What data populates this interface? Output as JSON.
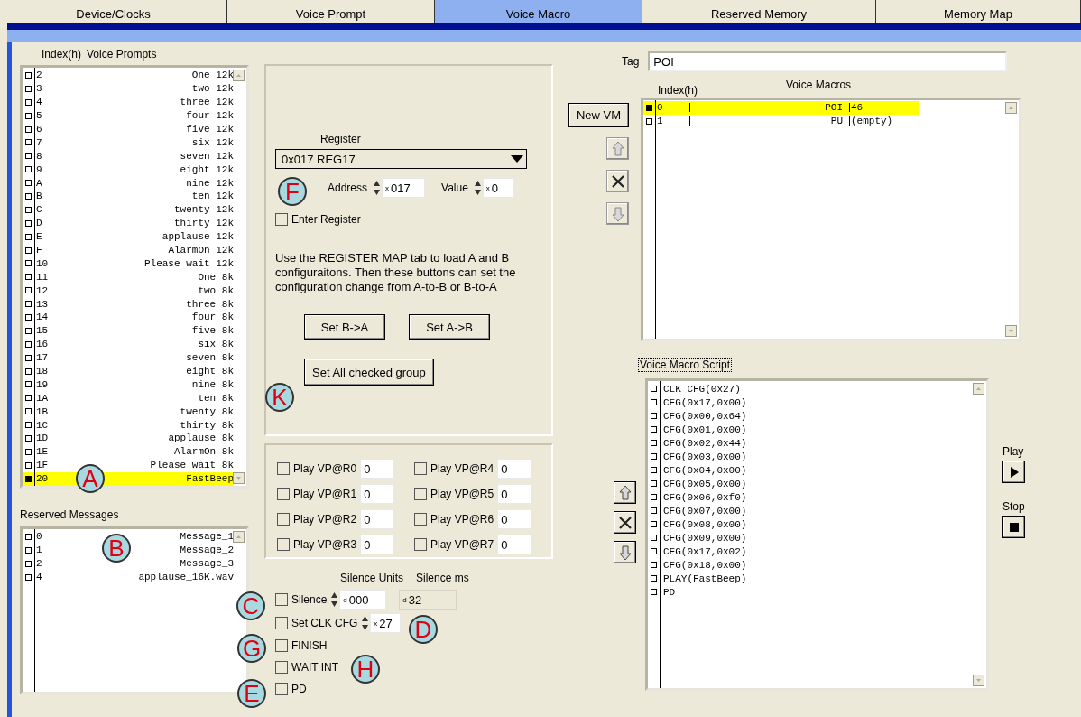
{
  "tabs": [
    {
      "label": "Device/Clocks",
      "selected": false
    },
    {
      "label": "Voice Prompt",
      "selected": false
    },
    {
      "label": "Voice Macro",
      "selected": true
    },
    {
      "label": "Reserved Memory",
      "selected": false
    },
    {
      "label": "Memory Map",
      "selected": false
    }
  ],
  "voice_prompts": {
    "index_header": "Index(h)",
    "title": "Voice Prompts",
    "rows": [
      {
        "index": "2",
        "name": "One 12k",
        "selected": false
      },
      {
        "index": "3",
        "name": "two 12k",
        "selected": false
      },
      {
        "index": "4",
        "name": "three 12k",
        "selected": false
      },
      {
        "index": "5",
        "name": "four 12k",
        "selected": false
      },
      {
        "index": "6",
        "name": "five 12k",
        "selected": false
      },
      {
        "index": "7",
        "name": "six 12k",
        "selected": false
      },
      {
        "index": "8",
        "name": "seven 12k",
        "selected": false
      },
      {
        "index": "9",
        "name": "eight 12k",
        "selected": false
      },
      {
        "index": "A",
        "name": "nine 12k",
        "selected": false
      },
      {
        "index": "B",
        "name": "ten 12k",
        "selected": false
      },
      {
        "index": "C",
        "name": "twenty 12k",
        "selected": false
      },
      {
        "index": "D",
        "name": "thirty 12k",
        "selected": false
      },
      {
        "index": "E",
        "name": "applause 12k",
        "selected": false
      },
      {
        "index": "F",
        "name": "AlarmOn 12k",
        "selected": false
      },
      {
        "index": "10",
        "name": "Please wait 12k",
        "selected": false
      },
      {
        "index": "11",
        "name": "One 8k",
        "selected": false
      },
      {
        "index": "12",
        "name": "two 8k",
        "selected": false
      },
      {
        "index": "13",
        "name": "three 8k",
        "selected": false
      },
      {
        "index": "14",
        "name": "four 8k",
        "selected": false
      },
      {
        "index": "15",
        "name": "five 8k",
        "selected": false
      },
      {
        "index": "16",
        "name": "six 8k",
        "selected": false
      },
      {
        "index": "17",
        "name": "seven 8k",
        "selected": false
      },
      {
        "index": "18",
        "name": "eight 8k",
        "selected": false
      },
      {
        "index": "19",
        "name": "nine 8k",
        "selected": false
      },
      {
        "index": "1A",
        "name": "ten 8k",
        "selected": false
      },
      {
        "index": "1B",
        "name": "twenty 8k",
        "selected": false
      },
      {
        "index": "1C",
        "name": "thirty 8k",
        "selected": false
      },
      {
        "index": "1D",
        "name": "applause 8k",
        "selected": false
      },
      {
        "index": "1E",
        "name": "AlarmOn 8k",
        "selected": false
      },
      {
        "index": "1F",
        "name": "Please wait 8k",
        "selected": false
      },
      {
        "index": "20",
        "name": "FastBeep",
        "selected": true
      }
    ]
  },
  "reserved_messages": {
    "title": "Reserved Messages",
    "rows": [
      {
        "index": "0",
        "name": "Message_1"
      },
      {
        "index": "1",
        "name": "Message_2"
      },
      {
        "index": "2",
        "name": "Message_3"
      },
      {
        "index": "4",
        "name": "applause_16K.wav"
      }
    ]
  },
  "register": {
    "label": "Register",
    "dropdown": "0x017 REG17",
    "address_label": "Address",
    "address_prefix": "x",
    "address": "017",
    "value_label": "Value",
    "value_prefix": "x",
    "value": "0",
    "enter_register": {
      "label": "Enter Register",
      "checked": false
    },
    "help": "Use the REGISTER MAP tab to load A and B configuraitons. Then these buttons can set the configuration change from A-to-B or B-to-A",
    "buttons": [
      "Set B->A",
      "Set A->B"
    ],
    "set_all": "Set All checked group"
  },
  "play_vp": [
    {
      "label": "Play VP@R0",
      "value": "0",
      "checked": false
    },
    {
      "label": "Play VP@R1",
      "value": "0",
      "checked": false
    },
    {
      "label": "Play VP@R2",
      "value": "0",
      "checked": false
    },
    {
      "label": "Play VP@R3",
      "value": "0",
      "checked": false
    },
    {
      "label": "Play VP@R4",
      "value": "0",
      "checked": false
    },
    {
      "label": "Play VP@R5",
      "value": "0",
      "checked": false
    },
    {
      "label": "Play VP@R6",
      "value": "0",
      "checked": false
    },
    {
      "label": "Play VP@R7",
      "value": "0",
      "checked": false
    }
  ],
  "silence": {
    "units_header": "Silence Units",
    "ms_header": "Silence ms",
    "options": [
      {
        "kind": "silence",
        "label": "Silence",
        "checked": false,
        "prefix": "d",
        "value": "000",
        "ms_prefix": "d",
        "ms": "32"
      },
      {
        "kind": "spinner",
        "label": "Set CLK CFG",
        "checked": false,
        "prefix": "x",
        "value": "27"
      },
      {
        "kind": "plain",
        "label": "FINISH",
        "checked": false
      },
      {
        "kind": "plain",
        "label": "WAIT INT",
        "checked": false
      },
      {
        "kind": "plain",
        "label": "PD",
        "checked": false
      }
    ]
  },
  "tag": {
    "label": "Tag",
    "value": "POI"
  },
  "voice_macros": {
    "index_header": "Index(h)",
    "title": "Voice Macros",
    "new_button": "New VM",
    "rows": [
      {
        "index": "0",
        "tag": "POI",
        "value": "46",
        "selected": true
      },
      {
        "index": "1",
        "tag": "PU",
        "value": "(empty)",
        "selected": false
      }
    ]
  },
  "script": {
    "title": "Voice Macro Script",
    "lines": [
      "CLK CFG(0x27)",
      "CFG(0x17,0x00)",
      "CFG(0x00,0x64)",
      "CFG(0x01,0x00)",
      "CFG(0x02,0x44)",
      "CFG(0x03,0x00)",
      "CFG(0x04,0x00)",
      "CFG(0x05,0x00)",
      "CFG(0x06,0xf0)",
      "CFG(0x07,0x00)",
      "CFG(0x08,0x00)",
      "CFG(0x09,0x00)",
      "CFG(0x17,0x02)",
      "CFG(0x18,0x00)",
      "PLAY(FastBeep)",
      "PD"
    ]
  },
  "playback": {
    "play_label": "Play",
    "stop_label": "Stop"
  },
  "callouts": [
    "A",
    "B",
    "C",
    "D",
    "G",
    "H",
    "E",
    "F",
    "K"
  ]
}
